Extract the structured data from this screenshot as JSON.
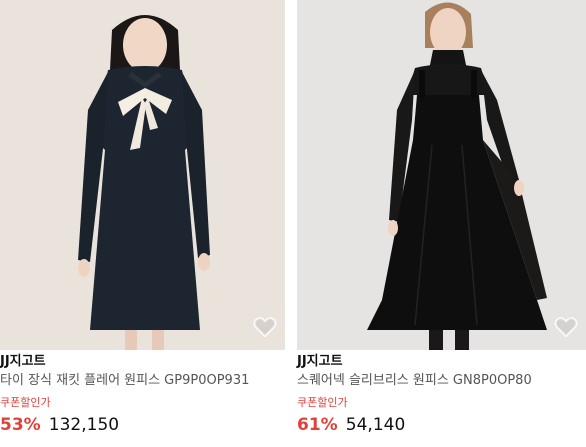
{
  "products": [
    {
      "brand": "JJ지고트",
      "name": "타이 장식 재킷 플레어 원피스 GP9P0OP931",
      "coupon_label": "쿠폰할인가",
      "discount": "53%",
      "price": "132,150",
      "image": "model-navy-tie-dress-photo",
      "wishlist_icon": "heart-icon"
    },
    {
      "brand": "JJ지고트",
      "name": "스퀘어넥 슬리브리스 원피스 GN8P0OP80",
      "coupon_label": "쿠폰할인가",
      "discount": "61%",
      "price": "54,140",
      "image": "model-black-sleeveless-dress-photo",
      "wishlist_icon": "heart-icon"
    }
  ],
  "colors": {
    "accent": "#e0413b",
    "background_left": "#e9e3dc",
    "background_right": "#e6e4e2"
  }
}
